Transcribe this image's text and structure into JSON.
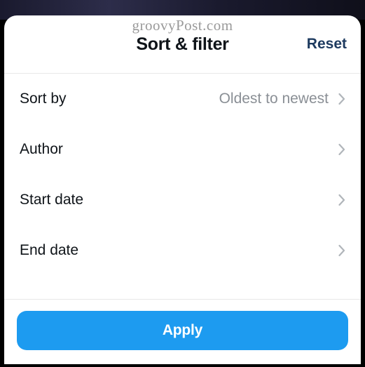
{
  "watermark": "groovyPost.com",
  "header": {
    "title": "Sort & filter",
    "reset_label": "Reset"
  },
  "rows": {
    "sort_by": {
      "label": "Sort by",
      "value": "Oldest to newest"
    },
    "author": {
      "label": "Author",
      "value": ""
    },
    "start_date": {
      "label": "Start date",
      "value": ""
    },
    "end_date": {
      "label": "End date",
      "value": ""
    }
  },
  "footer": {
    "apply_label": "Apply"
  }
}
